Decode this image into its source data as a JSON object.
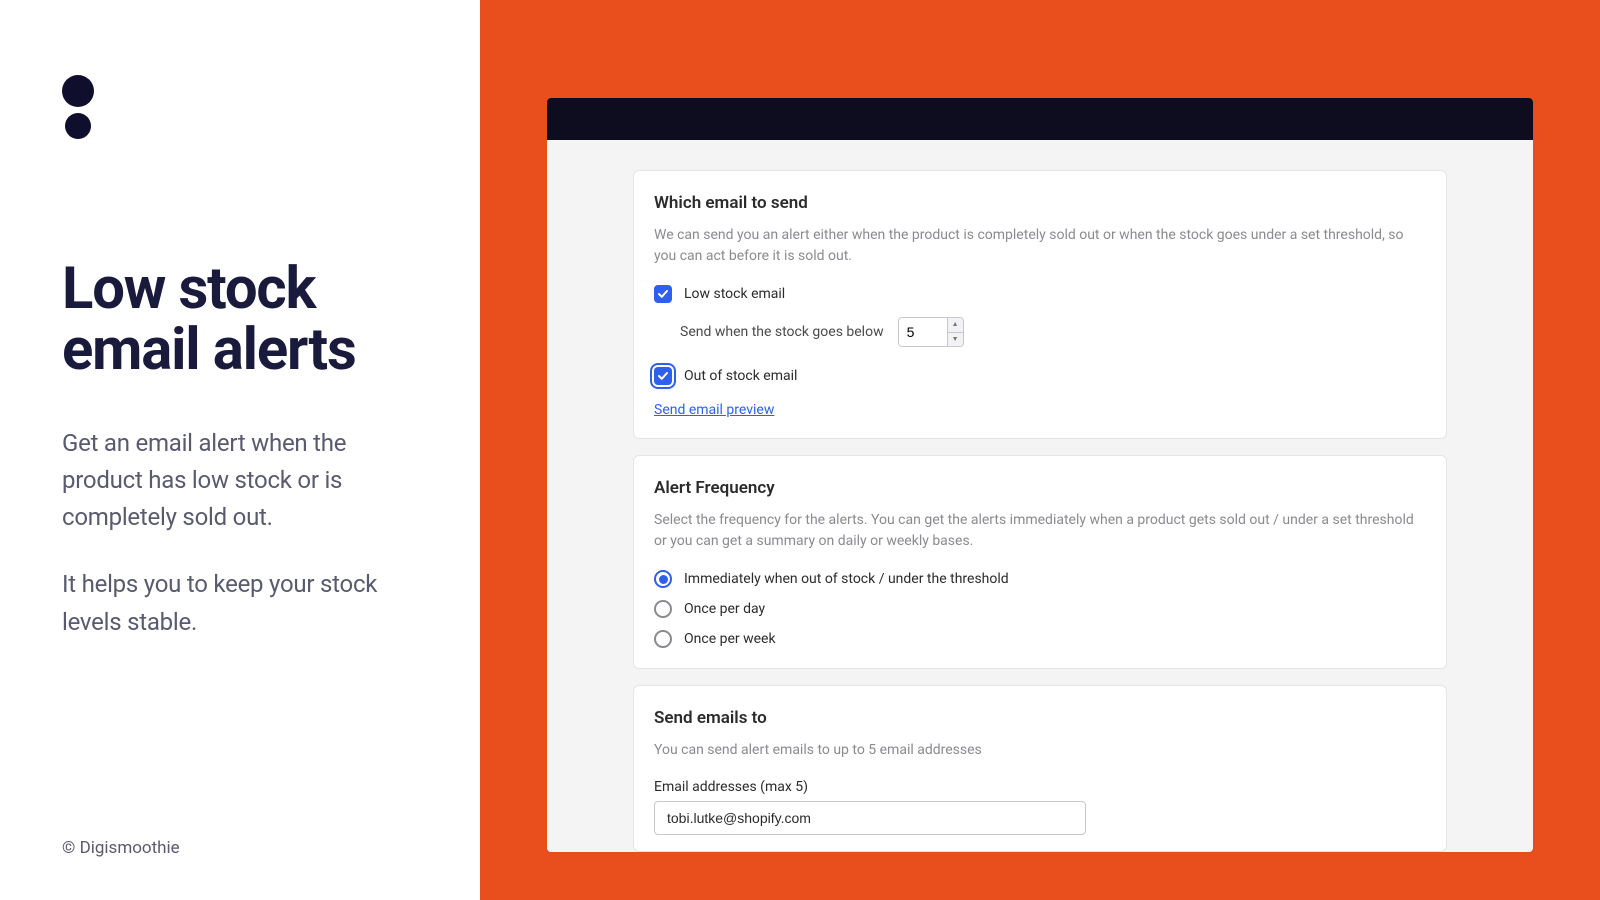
{
  "left": {
    "headline": "Low stock email alerts",
    "para1": "Get an email alert when the product has low stock or is completely sold out.",
    "para2": "It helps you to keep your stock levels stable.",
    "copyright": "© Digismoothie"
  },
  "card1": {
    "title": "Which email to send",
    "desc": "We can send you an alert either when the product is completely sold out or when the stock goes under a set threshold, so you can act before it is sold out.",
    "low_stock_label": "Low stock email",
    "threshold_label": "Send when the stock goes below",
    "threshold_value": "5",
    "out_of_stock_label": "Out of stock email",
    "preview_link": "Send email preview"
  },
  "card2": {
    "title": "Alert Frequency",
    "desc": "Select the frequency for the alerts. You can get the alerts immediately when a product gets sold out / under a set threshold or you can get a summary on daily or weekly bases.",
    "options": [
      "Immediately when out of stock / under the threshold",
      "Once per day",
      "Once per week"
    ]
  },
  "card3": {
    "title": "Send emails to",
    "desc": "You can send alert emails to up to 5 email addresses",
    "field_label": "Email addresses (max 5)",
    "email_value": "tobi.lutke@shopify.com"
  }
}
